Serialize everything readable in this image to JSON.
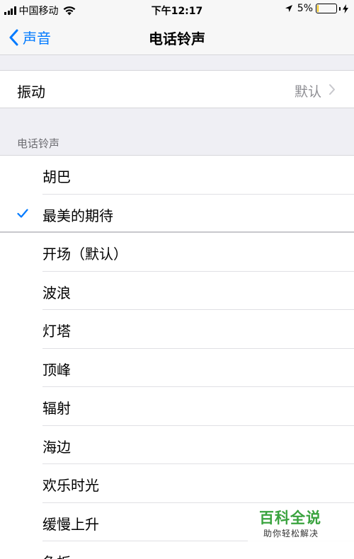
{
  "status_bar": {
    "carrier": "中国移动",
    "time": "下午12:17",
    "battery_percent": "5%",
    "signal_bars": 4,
    "battery_level": 0.05
  },
  "nav": {
    "back_label": "声音",
    "title": "电话铃声"
  },
  "vibration": {
    "label": "振动",
    "value": "默认"
  },
  "section": {
    "header": "电话铃声"
  },
  "ringtones": [
    {
      "name": "胡巴",
      "checked": false
    },
    {
      "name": "最美的期待",
      "checked": true,
      "group_end": true
    },
    {
      "name": "开场（默认）",
      "checked": false
    },
    {
      "name": "波浪",
      "checked": false
    },
    {
      "name": "灯塔",
      "checked": false
    },
    {
      "name": "顶峰",
      "checked": false
    },
    {
      "name": "辐射",
      "checked": false
    },
    {
      "name": "海边",
      "checked": false
    },
    {
      "name": "欢乐时光",
      "checked": false
    },
    {
      "name": "缓慢上升",
      "checked": false
    },
    {
      "name": "急板",
      "checked": false
    }
  ],
  "watermark": {
    "title": "百科全说",
    "subtitle": "助你轻松解决"
  },
  "colors": {
    "accent": "#007aff",
    "battery_low": "#f5c518",
    "watermark_green": "#3aa33f"
  }
}
